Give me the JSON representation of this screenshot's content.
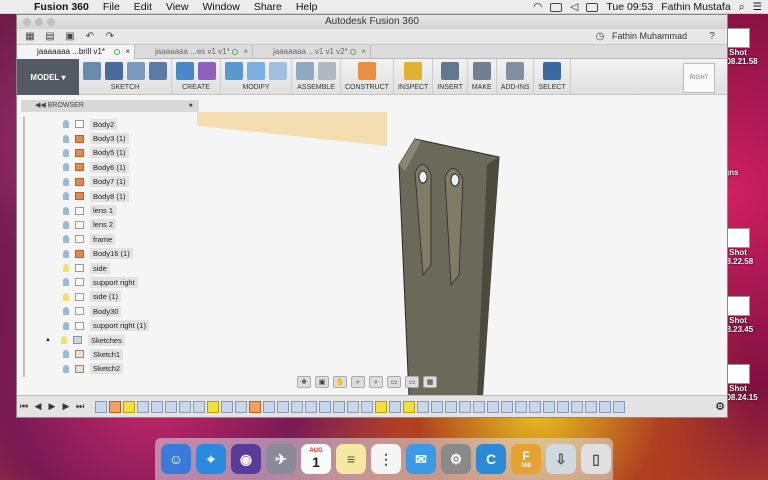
{
  "menubar": {
    "app_name": "Fusion 360",
    "items": [
      "File",
      "Edit",
      "View",
      "Window",
      "Share",
      "Help"
    ],
    "clock": "Tue 09:53",
    "user": "Fathin Mustafa"
  },
  "desktop": {
    "items": [
      {
        "label": "n Shot",
        "sub": "..08.21.58"
      },
      {
        "label": "igns",
        "sub": ""
      },
      {
        "label": "n Shot",
        "sub": "..8.22.58"
      },
      {
        "label": "n Shot",
        "sub": "..8.23.45"
      },
      {
        "label": "n Shot",
        "sub": "..08.24.15"
      }
    ]
  },
  "window": {
    "title": "Autodesk Fusion 360",
    "user_menu": "Fathin Muhammad",
    "tabs": [
      {
        "label": "jaaaaaaa ...brill v1*"
      },
      {
        "label": "jaaaaaaa ...es v1 v1*"
      },
      {
        "label": "jaaaaaaa ...v1 v1 v2*"
      }
    ]
  },
  "ribbon": {
    "workspace": "MODEL",
    "groups": [
      "SKETCH",
      "CREATE",
      "MODIFY",
      "ASSEMBLE",
      "CONSTRUCT",
      "INSPECT",
      "INSERT",
      "MAKE",
      "ADD-INS",
      "SELECT"
    ],
    "viewcube": "RIGHT"
  },
  "browser": {
    "title": "BROWSER",
    "items": [
      {
        "name": "Body2",
        "type": "body-blue"
      },
      {
        "name": "Body3 (1)",
        "type": "body"
      },
      {
        "name": "Body5 (1)",
        "type": "body"
      },
      {
        "name": "Body6 (1)",
        "type": "body"
      },
      {
        "name": "Body7 (1)",
        "type": "body"
      },
      {
        "name": "Body8 (1)",
        "type": "body"
      },
      {
        "name": "lens 1",
        "type": "body-blue"
      },
      {
        "name": "lens 2",
        "type": "body-blue"
      },
      {
        "name": "frame",
        "type": "body-blue"
      },
      {
        "name": "Body16 (1)",
        "type": "body"
      },
      {
        "name": "side",
        "type": "body-on"
      },
      {
        "name": "support right",
        "type": "body-blue"
      },
      {
        "name": "side (1)",
        "type": "body-on"
      },
      {
        "name": "Body30",
        "type": "body-blue"
      },
      {
        "name": "support right (1)",
        "type": "body-blue"
      }
    ],
    "folder": {
      "name": "Sketches"
    },
    "sketches": [
      {
        "name": "Sketch1"
      },
      {
        "name": "Sketch2"
      }
    ]
  },
  "dock": {
    "calendar_month": "AUG",
    "calendar_day": "1",
    "fusion_badge": "360"
  }
}
